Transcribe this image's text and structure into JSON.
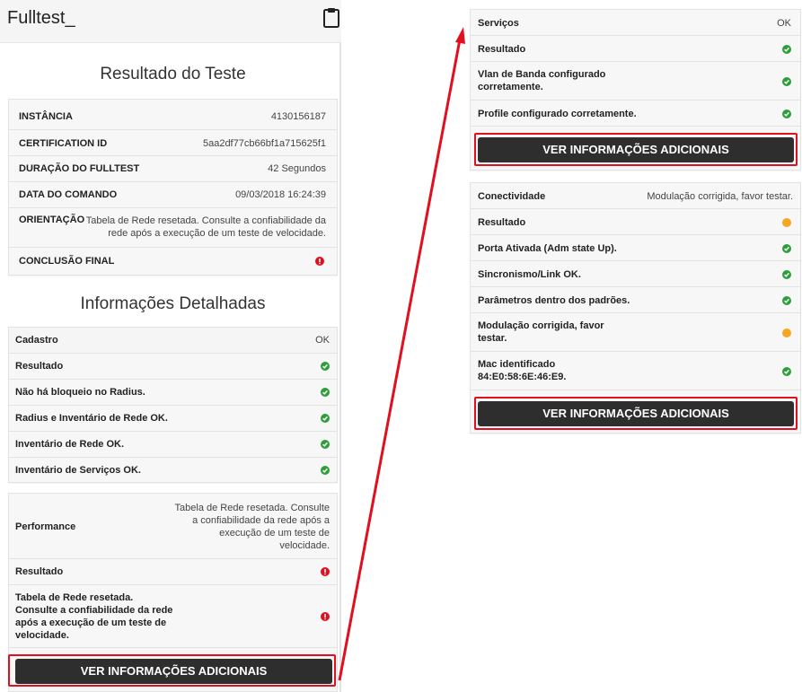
{
  "app": {
    "title": "Fulltest_",
    "clipboard_icon": "clipboard-icon"
  },
  "colors": {
    "ok": "#2e9e3a",
    "warn": "#f5a623",
    "error": "#e0101e",
    "button": "#2e2e2e",
    "highlight": "#e0101e"
  },
  "resultado": {
    "heading": "Resultado do Teste",
    "rows": [
      {
        "label": "INSTÂNCIA",
        "value": "4130156187"
      },
      {
        "label": "CERTIFICATION ID",
        "value": "5aa2df77cb66bf1a715625f1"
      },
      {
        "label": "DURAÇÃO DO FULLTEST",
        "value": "42 Segundos"
      },
      {
        "label": "DATA DO COMANDO",
        "value": "09/03/2018 16:24:39"
      },
      {
        "label": "ORIENTAÇÃO",
        "value": "Tabela de Rede resetada. Consulte a confiabilidade da rede após a execução de um teste de velocidade."
      },
      {
        "label": "CONCLUSÃO FINAL",
        "status": "error"
      }
    ]
  },
  "detalhes": {
    "heading": "Informações Detalhadas",
    "cadastro": {
      "label": "Cadastro",
      "value": "OK",
      "items": [
        {
          "label": "Resultado",
          "status": "ok"
        },
        {
          "label": "Não há bloqueio no Radius.",
          "status": "ok"
        },
        {
          "label": "Radius e Inventário de Rede OK.",
          "status": "ok"
        },
        {
          "label": "Inventário de Rede OK.",
          "status": "ok"
        },
        {
          "label": "Inventário de Serviços OK.",
          "status": "ok"
        }
      ]
    },
    "performance": {
      "label": "Performance",
      "value": "Tabela de Rede resetada. Consulte a confiabilidade da rede após a execução de um teste de velocidade.",
      "items": [
        {
          "label": "Resultado",
          "status": "error"
        },
        {
          "label": "Tabela de Rede resetada. Consulte a confiabilidade da rede após a execução de um teste de velocidade.",
          "status": "error"
        }
      ],
      "button": "VER INFORMAÇÕES ADICIONAIS"
    }
  },
  "servicos": {
    "label": "Serviços",
    "value": "OK",
    "items": [
      {
        "label": "Resultado",
        "status": "ok"
      },
      {
        "label": "Vlan de Banda configurado corretamente.",
        "status": "ok"
      },
      {
        "label": "Profile configurado corretamente.",
        "status": "ok"
      }
    ],
    "button": "VER INFORMAÇÕES ADICIONAIS"
  },
  "conectividade": {
    "label": "Conectividade",
    "value": "Modulação corrigida, favor testar.",
    "items": [
      {
        "label": "Resultado",
        "status": "warn"
      },
      {
        "label": "Porta Ativada (Adm state Up).",
        "status": "ok"
      },
      {
        "label": "Sincronismo/Link OK.",
        "status": "ok"
      },
      {
        "label": "Parâmetros dentro dos padrões.",
        "status": "ok"
      },
      {
        "label": "Modulação corrigida, favor testar.",
        "status": "warn"
      },
      {
        "label": "Mac identificado 84:E0:58:6E:46:E9.",
        "status": "ok"
      }
    ],
    "button": "VER INFORMAÇÕES ADICIONAIS"
  }
}
